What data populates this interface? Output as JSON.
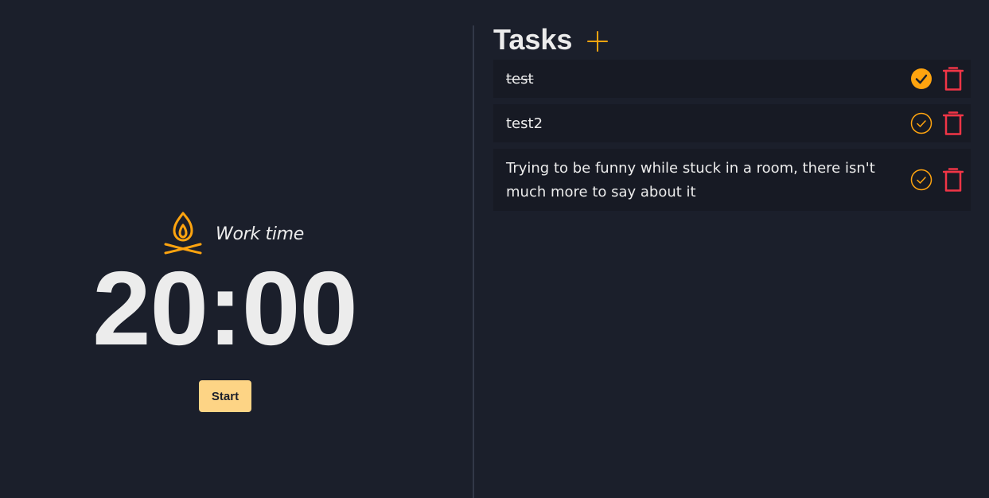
{
  "colors": {
    "background": "#1b1f2b",
    "task_background": "#171a24",
    "accent_orange": "#ffa40f",
    "start_button": "#fdd485",
    "delete_red": "#f03546",
    "text": "#ececec"
  },
  "timer": {
    "mode_icon": "campfire-icon",
    "mode_label": "Work time",
    "time": "20:00",
    "start_label": "Start"
  },
  "tasks": {
    "title": "Tasks",
    "add_icon": "plus-icon",
    "items": [
      {
        "text": "test",
        "done": true
      },
      {
        "text": "test2",
        "done": false
      },
      {
        "text": "Trying to be funny while stuck in a room, there isn't much more to say about it",
        "done": false
      }
    ]
  }
}
